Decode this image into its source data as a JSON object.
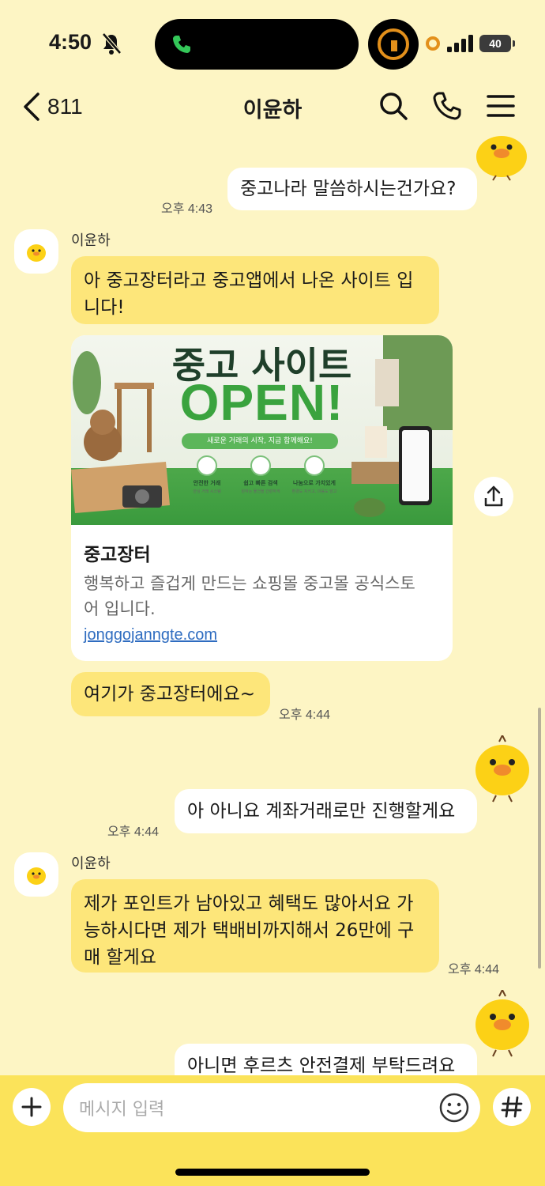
{
  "status_bar": {
    "time": "4:50",
    "battery": "40"
  },
  "header": {
    "back_count": "811",
    "title": "이윤하"
  },
  "messages": {
    "m1": {
      "text": "중고나라 말씀하시는건가요?",
      "time": "오후 4:43"
    },
    "m2": {
      "sender": "이윤하",
      "line1": "아 중고장터라고 중고앱에서 나온 사이트 입",
      "line2": "니다!"
    },
    "link_card": {
      "banner_title": "중고 사이트",
      "banner_open": "OPEN!",
      "banner_pill": "새로운 거래의 시작, 지금 함께해요!",
      "features": [
        {
          "title": "안전한 거래",
          "sub": "안심 거래 시스템"
        },
        {
          "title": "쉽고 빠른 검색",
          "sub": "원하는 물건을 간편하게"
        },
        {
          "title": "나눔으로 가치있게",
          "sub": "환경도 지키고, 마음도 담고"
        }
      ],
      "title": "중고장터",
      "desc_line1": "행복하고 즐겁게 만드는 쇼핑몰 중고몰 공식스토",
      "desc_line2": "어 입니다.",
      "url": "jonggojanngte.com"
    },
    "m3": {
      "text": "여기가 중고장터에요~",
      "time": "오후 4:44"
    },
    "m4": {
      "text": "아 아니요 계좌거래로만 진행할게요",
      "time": "오후 4:44"
    },
    "m5": {
      "sender": "이윤하",
      "line1": "제가 포인트가 남아있고 혜택도 많아서요 가",
      "line2": "능하시다면 제가 택배비까지해서 26만에 구",
      "line3": "매 할게요",
      "time": "오후 4:44"
    },
    "m6": {
      "text": "아니면 후르츠 안전결제 부탁드려요"
    }
  },
  "input": {
    "placeholder": "메시지 입력"
  }
}
